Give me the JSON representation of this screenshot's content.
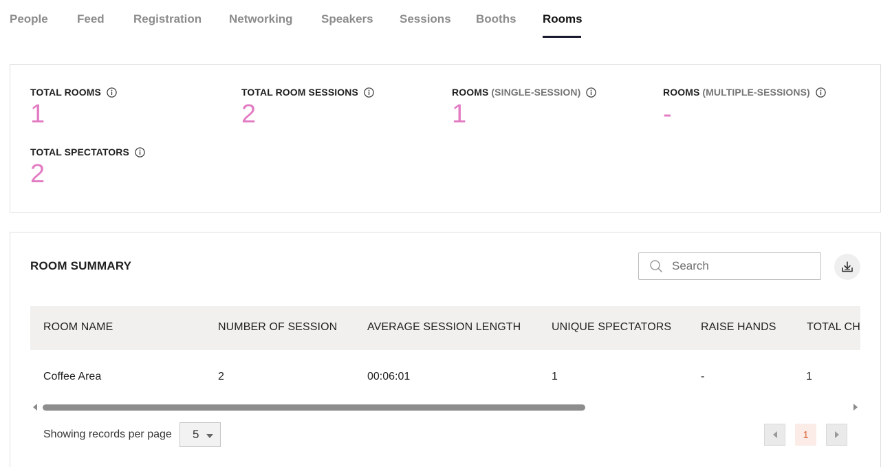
{
  "tabs": [
    {
      "label": "People"
    },
    {
      "label": "Feed"
    },
    {
      "label": "Registration"
    },
    {
      "label": "Networking"
    },
    {
      "label": "Speakers"
    },
    {
      "label": "Sessions"
    },
    {
      "label": "Booths"
    },
    {
      "label": "Rooms",
      "active": true
    }
  ],
  "stats": {
    "total_rooms": {
      "label": "TOTAL ROOMS",
      "value": "1"
    },
    "total_room_sessions": {
      "label": "TOTAL ROOM SESSIONS",
      "value": "2"
    },
    "rooms_single": {
      "label": "ROOMS",
      "sub": "(SINGLE-SESSION)",
      "value": "1"
    },
    "rooms_multiple": {
      "label": "ROOMS",
      "sub": "(MULTIPLE-SESSIONS)",
      "value": "-"
    },
    "total_spectators": {
      "label": "TOTAL SPECTATORS",
      "value": "2"
    }
  },
  "summary": {
    "title": "ROOM SUMMARY",
    "search_placeholder": "Search",
    "columns": [
      "ROOM NAME",
      "NUMBER OF SESSION",
      "AVERAGE SESSION LENGTH",
      "UNIQUE SPECTATORS",
      "RAISE HANDS",
      "TOTAL CHATS"
    ],
    "rows": [
      [
        "Coffee Area",
        "2",
        "00:06:01",
        "1",
        "-",
        "1"
      ]
    ],
    "records_label": "Showing records per page",
    "records_per_page": "5",
    "current_page": "1"
  },
  "colors": {
    "accent_value": "#e37bc3",
    "active_tab_underline": "#1a1a2e",
    "current_page_bg": "#fbece7",
    "current_page_text": "#e06a3c"
  }
}
